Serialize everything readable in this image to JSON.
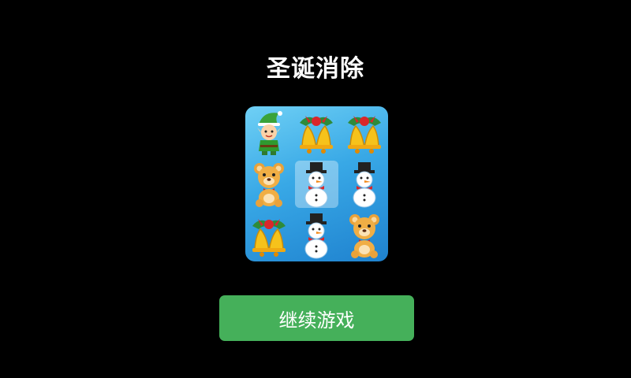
{
  "title": "圣诞消除",
  "game_icon": {
    "tiles": [
      [
        "elf-icon",
        "bell-icon",
        "bell-icon"
      ],
      [
        "teddy-bear-icon",
        "snowman-icon",
        "snowman-icon"
      ],
      [
        "bell-icon",
        "snowman-icon",
        "teddy-bear-icon"
      ]
    ],
    "colors": {
      "background": "#38a8e6",
      "highlight": "#bfe8fb"
    }
  },
  "continue_button": {
    "label": "继续游戏",
    "color": "#45b05a"
  }
}
